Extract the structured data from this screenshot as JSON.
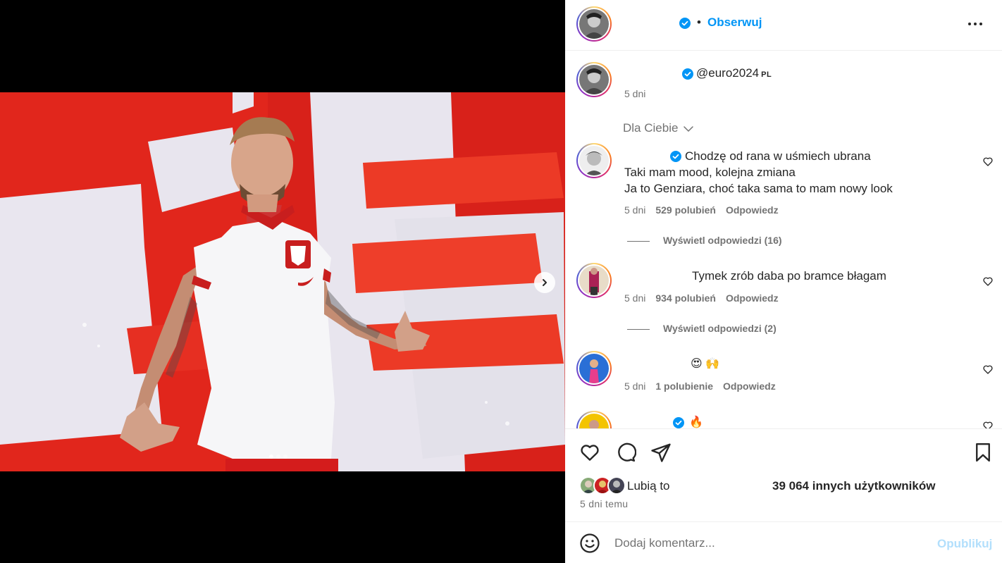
{
  "header": {
    "follow_label": "Obserwuj",
    "separator": "•"
  },
  "caption": {
    "tag": "@euro2024",
    "tag_suffix": "PL",
    "time": "5 dni"
  },
  "comments_filter": "Dla Ciebie",
  "comments": [
    {
      "lines": [
        "Chodzę od rana w uśmiech ubrana",
        "Taki mam mood, kolejna zmiana",
        "Ja to Genziara, choć taka sama to mam nowy look"
      ],
      "time": "5 dni",
      "likes": "529 polubień",
      "reply": "Odpowiedz",
      "view_replies": "Wyświetl odpowiedzi (16)"
    },
    {
      "lines": [
        "Tymek zrób daba po bramce błagam"
      ],
      "time": "5 dni",
      "likes": "934 polubień",
      "reply": "Odpowiedz",
      "view_replies": "Wyświetl odpowiedzi (2)"
    },
    {
      "lines": [
        "😍 🙌"
      ],
      "time": "5 dni",
      "likes": "1 polubienie",
      "reply": "Odpowiedz"
    },
    {
      "lines": [
        "🔥"
      ]
    }
  ],
  "likes": {
    "prefix": "Lubią to",
    "count": "39 064 innych użytkowników"
  },
  "post_date": "5 dni temu",
  "comment_box": {
    "placeholder": "Dodaj komentarz...",
    "publish_label": "Opublikuj"
  },
  "colors": {
    "accent": "#0095f6",
    "muted": "#737373",
    "publish_disabled": "#b2dffc",
    "photo_red": "#e1261c"
  },
  "icons": [
    "chevron-right-icon",
    "verified-icon",
    "more-icon",
    "chevron-down-icon",
    "heart-icon",
    "comment-icon",
    "share-icon",
    "bookmark-icon",
    "emoji-icon"
  ]
}
